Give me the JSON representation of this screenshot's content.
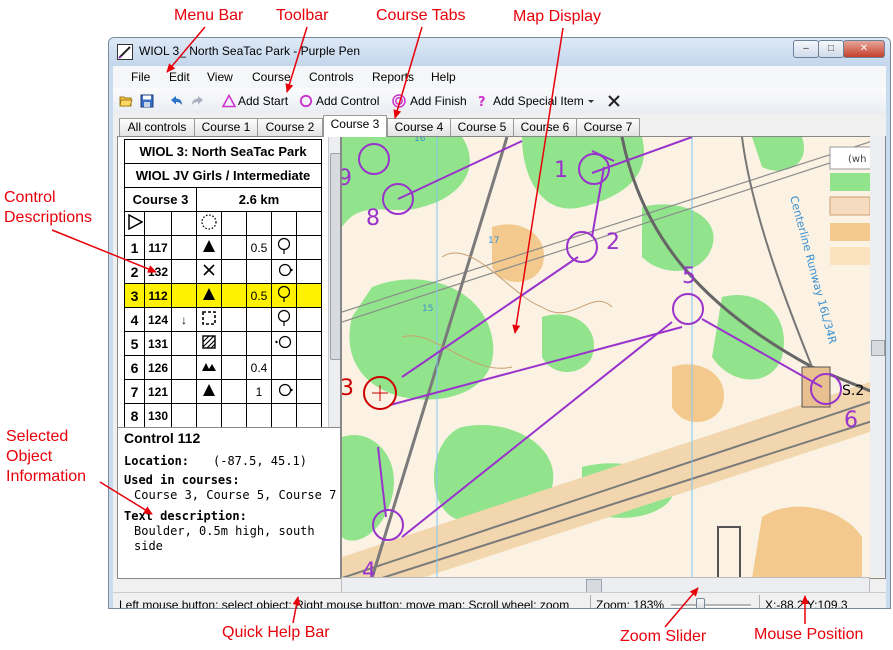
{
  "annotations": {
    "menu_bar": "Menu Bar",
    "toolbar": "Toolbar",
    "course_tabs": "Course Tabs",
    "map_display": "Map Display",
    "control_descriptions": "Control\nDescriptions",
    "selected_object_info": "Selected\nObject\nInformation",
    "quick_help_bar": "Quick Help Bar",
    "zoom_slider": "Zoom Slider",
    "mouse_position": "Mouse Position"
  },
  "window": {
    "title": "WIOL 3_ North SeaTac Park - Purple Pen",
    "controls": {
      "minimize": "–",
      "maximize": "□",
      "close": "✕"
    }
  },
  "menu": [
    "File",
    "Edit",
    "View",
    "Course",
    "Controls",
    "Reports",
    "Help"
  ],
  "toolbar": {
    "add_start": "Add Start",
    "add_control": "Add Control",
    "add_finish": "Add Finish",
    "add_special": "Add Special Item",
    "icons": [
      "open-folder-icon",
      "save-icon",
      "undo-icon",
      "redo-icon",
      "start-triangle-icon",
      "control-circle-icon",
      "finish-circle-icon",
      "question-mark-icon",
      "dropdown-arrow-icon",
      "delete-x-icon"
    ]
  },
  "tabs": [
    "All controls",
    "Course 1",
    "Course 2",
    "Course 3",
    "Course 4",
    "Course 5",
    "Course 6",
    "Course 7"
  ],
  "active_tab": "Course 3",
  "descriptions": {
    "event": "WIOL 3: North SeaTac Park",
    "class": "WIOL JV Girls / Intermediate",
    "course": "Course 3",
    "length": "2.6 km",
    "rows": [
      {
        "num": "1",
        "code": "117",
        "dir": "",
        "feat": "triangle",
        "size": "0.5",
        "loc": "circle-stem"
      },
      {
        "num": "2",
        "code": "132",
        "dir": "",
        "feat": "cross",
        "size": "",
        "loc": "circle-dot-left"
      },
      {
        "num": "3",
        "code": "112",
        "dir": "",
        "feat": "triangle",
        "size": "0.5",
        "loc": "circle-stem",
        "selected": true
      },
      {
        "num": "4",
        "code": "124",
        "dir": "↓",
        "feat": "dashed-square",
        "size": "",
        "loc": "circle-stem"
      },
      {
        "num": "5",
        "code": "131",
        "dir": "",
        "feat": "hatched-square",
        "size": "",
        "loc": "circle-dot-right"
      },
      {
        "num": "6",
        "code": "126",
        "dir": "",
        "feat": "boulders",
        "size": "0.4",
        "loc": ""
      },
      {
        "num": "7",
        "code": "121",
        "dir": "",
        "feat": "triangle",
        "size": "1",
        "loc": "circle-dot-left"
      },
      {
        "num": "8",
        "code": "130",
        "dir": "",
        "feat": "",
        "size": "",
        "loc": ""
      }
    ]
  },
  "info": {
    "title": "Control 112",
    "location_label": "Location:",
    "location_value": "(-87.5, 45.1)",
    "used_label": "Used in courses:",
    "used_value": "Course 3, Course 5, Course 7",
    "text_label": "Text description:",
    "text_line1": "Boulder, 0.5m high, south",
    "text_line2": "side"
  },
  "map": {
    "control_numbers": [
      "1",
      "2",
      "3",
      "4",
      "5",
      "6",
      "8",
      "9"
    ],
    "legend_text": "(wh",
    "road_label": "Centerline Runway 16L/34R",
    "tiny_numbers": [
      "16",
      "15",
      "17"
    ],
    "sign": "S.2",
    "colors": {
      "purple": "#9933cc",
      "red": "#cc0000",
      "green": "#8ee38a",
      "tan": "#f5d0a0",
      "white": "#ffffff",
      "grey": "#8c8c8c"
    }
  },
  "status": {
    "help": "Left mouse button: select object;   Right mouse button: move map;   Scroll wheel: zoom",
    "zoom": "Zoom: 183%",
    "zoom_level": 0.35,
    "position": "X:-88.2 Y:109.3"
  }
}
